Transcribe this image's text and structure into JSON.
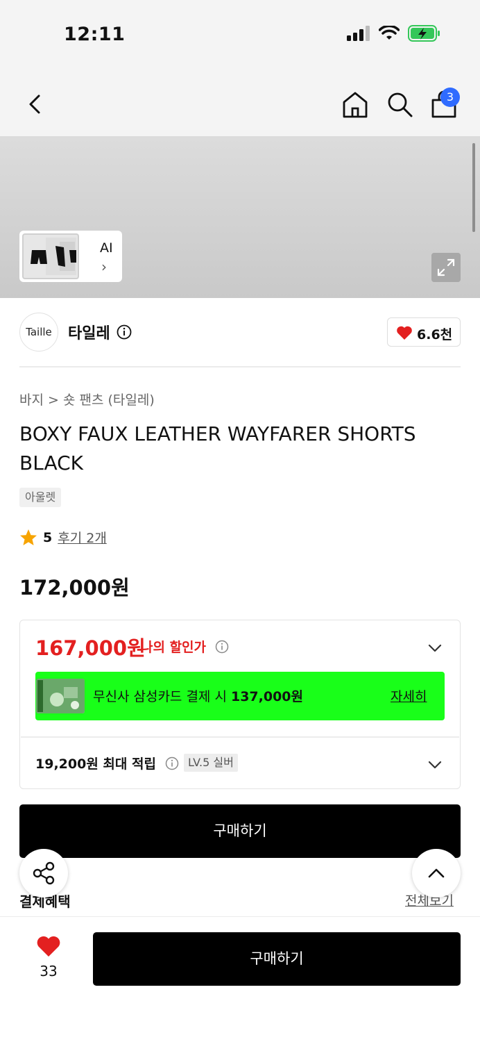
{
  "status_bar": {
    "time": "12:11"
  },
  "header": {
    "cart_count": "3"
  },
  "gallery": {
    "ai_label": "AI",
    "ai_chevron": "›"
  },
  "brand": {
    "logo_text": "Taille",
    "name": "타일레",
    "likes": "6.6천"
  },
  "product": {
    "breadcrumb": "바지 > 숏 팬츠 (타일레)",
    "title": "BOXY FAUX LEATHER WAYFARER SHORTS BLACK",
    "tag": "아울렛",
    "rating": "5",
    "reviews": "후기 2개",
    "price": "172,000원"
  },
  "discount": {
    "my_price": "167,000원",
    "my_price_label": "나의 할인가",
    "promo_prefix": "무신사 삼성카드 결제 시 ",
    "promo_amount": "137,000원",
    "promo_link": "자세히",
    "points": "19,200원 최대 적립",
    "level": "LV.5 실버"
  },
  "buttons": {
    "buy_main": "구매하기",
    "buy_bottom": "구매하기"
  },
  "section": {
    "benefit_title": "결제혜택",
    "view_all": "전체보기"
  },
  "bottom": {
    "wish_count": "33"
  },
  "colors": {
    "accent_red": "#e32020",
    "promo_green": "#19ff19",
    "badge_blue": "#2f6bff"
  },
  "icons": [
    "back-icon",
    "home-icon",
    "search-icon",
    "bag-icon",
    "info-icon",
    "heart-icon",
    "star-icon",
    "chevron-down-icon",
    "share-icon",
    "chevron-up-icon",
    "expand-icon"
  ]
}
